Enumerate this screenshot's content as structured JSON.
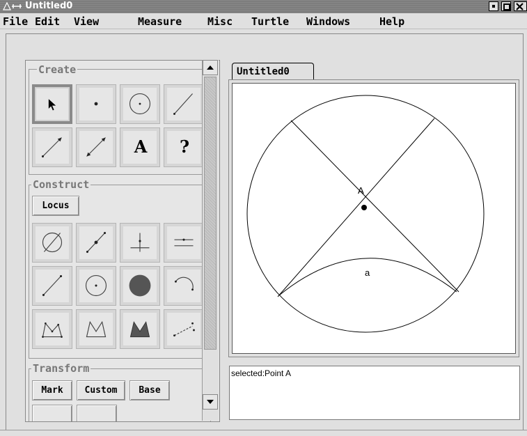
{
  "window": {
    "title": "Untitled0"
  },
  "menubar": {
    "items": [
      "File",
      "Edit",
      "View",
      "Measure",
      "Misc",
      "Turtle",
      "Windows",
      "Help"
    ]
  },
  "tools": {
    "create_label": "Create",
    "construct_label": "Construct",
    "transform_label": "Transform",
    "locus_label": "Locus",
    "text_tool_glyph": "A",
    "help_tool_glyph": "?",
    "transform_buttons": [
      "Mark",
      "Custom",
      "Base"
    ]
  },
  "canvas": {
    "tab_label": "Untitled0",
    "point_label": "A",
    "arc_label": "a"
  },
  "status": {
    "text": "selected:Point A"
  }
}
